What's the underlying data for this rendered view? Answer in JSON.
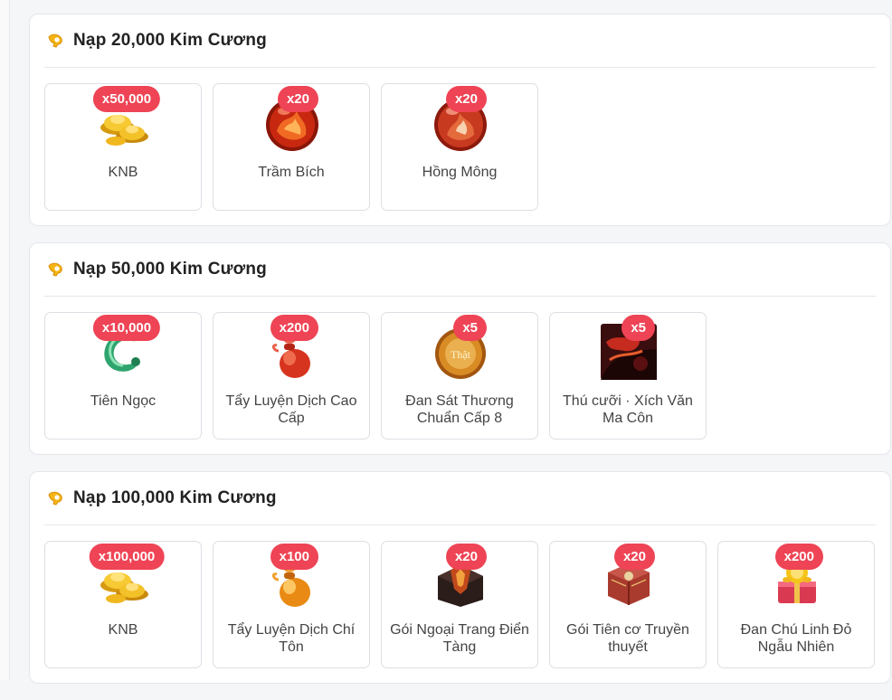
{
  "sections": [
    {
      "title": "Nạp 20,000 Kim Cương",
      "items": [
        {
          "name": "KNB",
          "qty": "x50,000",
          "icon": "gold-ingot-icon"
        },
        {
          "name": "Trầm Bích",
          "qty": "x20",
          "icon": "red-orb-icon"
        },
        {
          "name": "Hồng Mông",
          "qty": "x20",
          "icon": "red-orb-icon"
        }
      ]
    },
    {
      "title": "Nạp 50,000 Kim Cương",
      "items": [
        {
          "name": "Tiên Ngọc",
          "qty": "x10,000",
          "icon": "jade-dragon-icon"
        },
        {
          "name": "Tẩy Luyện Dịch Cao Cấp",
          "qty": "x200",
          "icon": "red-gourd-icon"
        },
        {
          "name": "Đan Sát Thương Chuẩn Cấp 8",
          "qty": "x5",
          "icon": "bronze-pill-icon",
          "icon_text": "Thật"
        },
        {
          "name": "Thú cưỡi · Xích Văn Ma Côn",
          "qty": "x5",
          "icon": "mount-portrait-icon"
        }
      ]
    },
    {
      "title": "Nạp 100,000 Kim Cương",
      "items": [
        {
          "name": "KNB",
          "qty": "x100,000",
          "icon": "gold-ingot-icon"
        },
        {
          "name": "Tẩy Luyện Dịch Chí Tôn",
          "qty": "x100",
          "icon": "gold-gourd-icon"
        },
        {
          "name": "Gói Ngoại Trang Điển Tàng",
          "qty": "x20",
          "icon": "dark-chest-icon"
        },
        {
          "name": "Gói Tiên cơ Truyền thuyết",
          "qty": "x20",
          "icon": "red-box-icon"
        },
        {
          "name": "Đan Chú Linh Đỏ Ngẫu Nhiên",
          "qty": "x200",
          "icon": "treasure-chest-icon"
        }
      ]
    }
  ]
}
